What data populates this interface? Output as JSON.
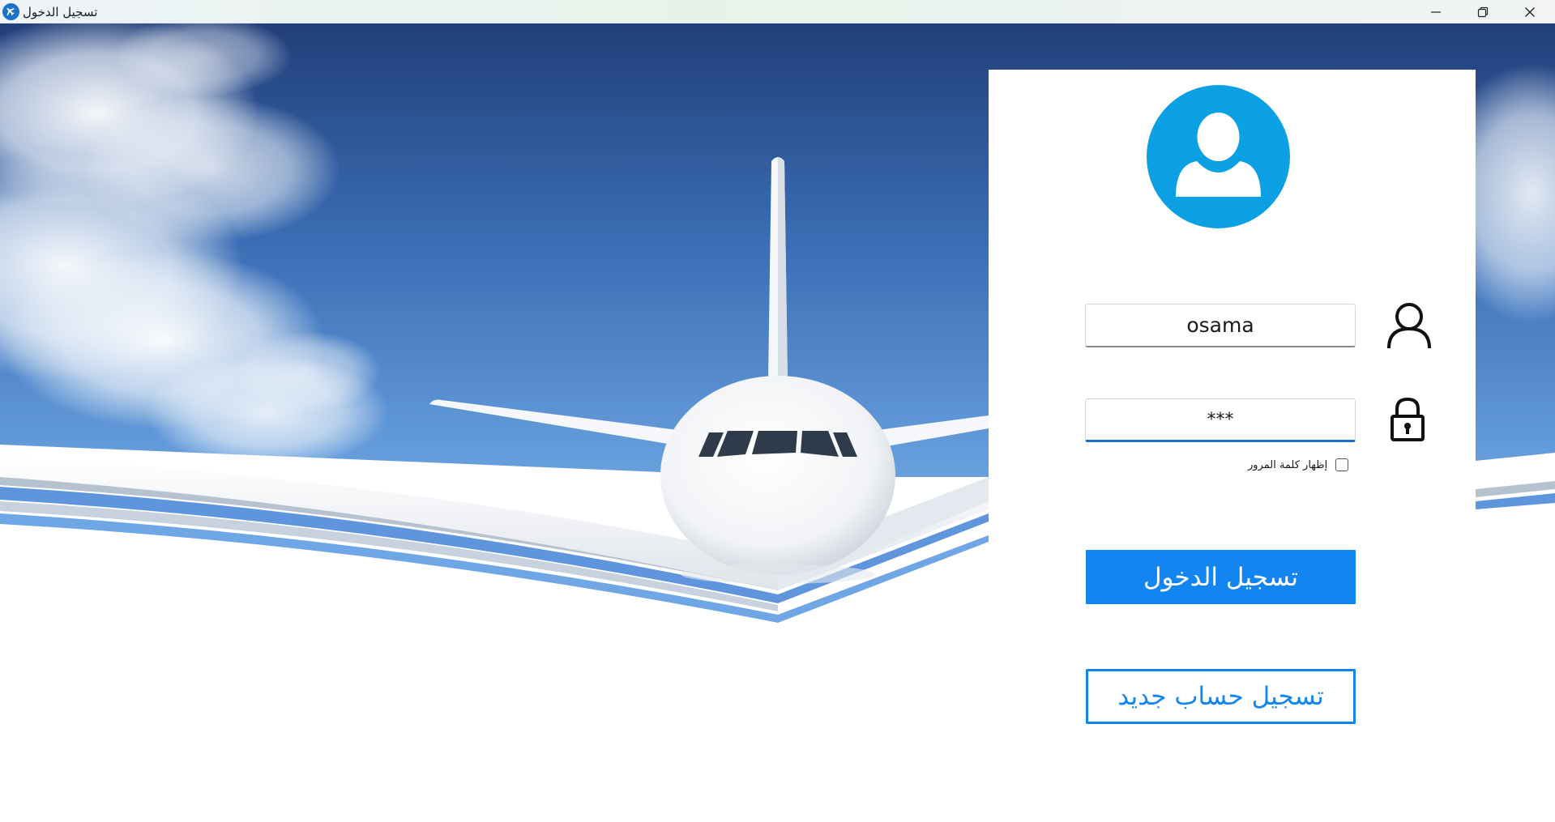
{
  "window": {
    "title": "تسجيل الدخول",
    "minimize_icon": "minimize-icon",
    "maximize_icon": "restore-icon",
    "close_icon": "close-icon"
  },
  "login": {
    "username_value": "osama",
    "password_value": "***",
    "show_password_label": "إظهار كلمة المرور",
    "show_password_checked": false,
    "login_button": "تسجيل الدخول",
    "register_button": "تسجيل حساب جديد"
  },
  "colors": {
    "accent": "#1385f0",
    "avatar": "#0aa0e3",
    "sky_top": "#223f7a",
    "sky_bottom": "#6aa6e6"
  }
}
